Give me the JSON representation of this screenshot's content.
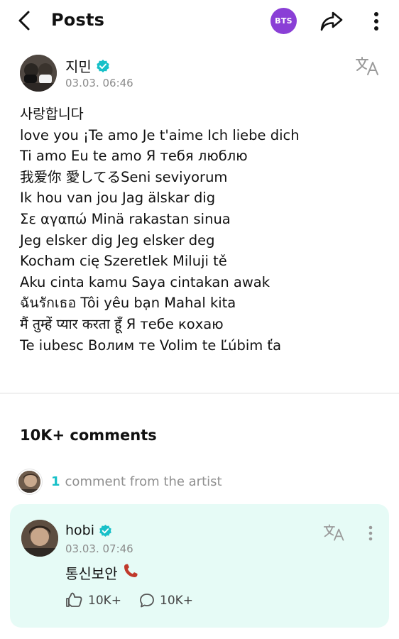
{
  "header": {
    "title": "Posts",
    "community_badge": "BTS",
    "icons": {
      "back": "back-arrow-icon",
      "share": "share-icon",
      "more": "more-vertical-icon"
    },
    "badge_color": "#8a3fd6"
  },
  "post": {
    "author": "지민",
    "verified": true,
    "timestamp": "03.03. 06:46",
    "lines": [
      "사랑합니다",
      "love you ¡Te amo Je t'aime Ich liebe dich",
      "Ti amo Eu te amo Я тебя люблю",
      "我爱你 愛してるSeni seviyorum",
      "Ik hou van jou Jag älskar dig",
      "Σε αγαπώ Minä rakastan sinua",
      "Jeg elsker dig Jeg elsker deg",
      "Kocham cię Szeretlek Miluji tě",
      "Aku cinta kamu Saya cintakan awak",
      "ฉันรักเธอ Tôi yêu bạn Mahal kita",
      "मैं तुम्हें प्यार करता हूँ   Я тебе кохаю",
      "Te iubesc Волим те Volim te Ľúbim ťa"
    ]
  },
  "comments": {
    "heading": "10K+ comments",
    "artist_comment_count": "1",
    "artist_comment_label": "comment from the artist",
    "accent_color": "#17c0c8",
    "card_color": "#e6fbf6",
    "items": [
      {
        "author": "hobi",
        "verified": true,
        "timestamp": "03.03. 07:46",
        "text": "통신보안",
        "emoji": "📞",
        "likes": "10K+",
        "replies": "10K+"
      }
    ]
  }
}
